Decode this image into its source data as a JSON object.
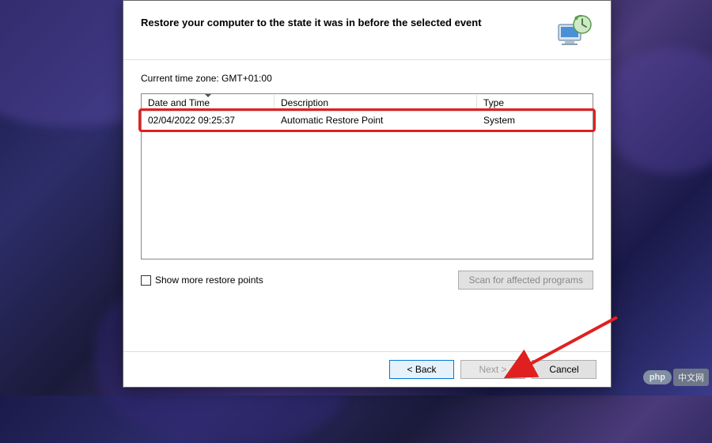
{
  "dialog": {
    "title": "Restore your computer to the state it was in before the selected event",
    "timezone_label": "Current time zone: GMT+01:00"
  },
  "table": {
    "headers": {
      "datetime": "Date and Time",
      "description": "Description",
      "type": "Type"
    },
    "rows": [
      {
        "datetime": "02/04/2022 09:25:37",
        "description": "Automatic Restore Point",
        "type": "System"
      }
    ]
  },
  "options": {
    "show_more_label": "Show more restore points",
    "scan_label": "Scan for affected programs"
  },
  "buttons": {
    "back": "< Back",
    "next": "Next >",
    "cancel": "Cancel"
  },
  "watermark": {
    "badge": "php",
    "text": "中文网"
  }
}
